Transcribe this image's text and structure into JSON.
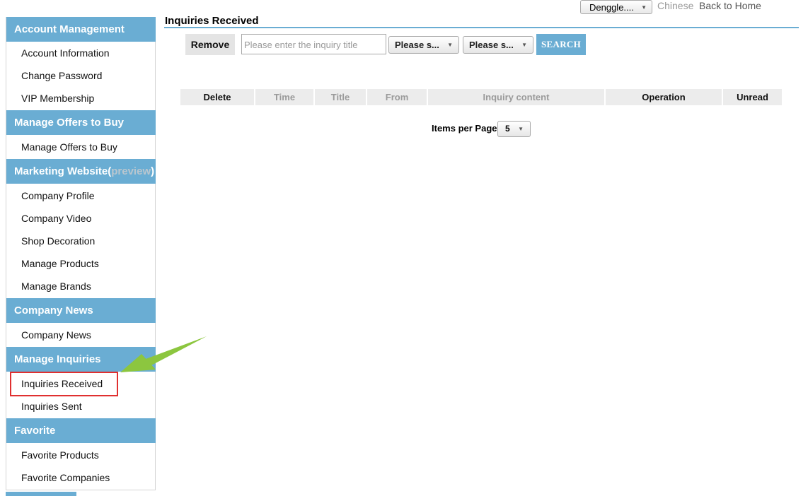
{
  "topbar": {
    "user": "Denggle....",
    "language": "Chinese",
    "home": "Back to Home"
  },
  "sidebar": {
    "sections": [
      {
        "title": "Account Management",
        "items": [
          "Account Information",
          "Change Password",
          "VIP Membership"
        ]
      },
      {
        "title": "Manage Offers to Buy",
        "items": [
          "Manage Offers to Buy"
        ]
      },
      {
        "title": "Marketing Website(",
        "title_link": "preview",
        "title_end": ")",
        "items": [
          "Company Profile",
          "Company Video",
          "Shop Decoration",
          "Manage Products",
          "Manage Brands"
        ]
      },
      {
        "title": "Company News",
        "items": [
          "Company News"
        ]
      },
      {
        "title": "Manage Inquiries",
        "items": [
          "Inquiries Received",
          "Inquiries Sent"
        ]
      },
      {
        "title": "Favorite",
        "items": [
          "Favorite Products",
          "Favorite Companies"
        ]
      }
    ],
    "highlighted_item": "Inquiries Received"
  },
  "main": {
    "title": "Inquiries Received",
    "toolbar": {
      "remove_label": "Remove",
      "search_placeholder": "Please enter the inquiry title",
      "filter1": "Please s...",
      "filter2": "Please s...",
      "search_label": "SEARCH"
    },
    "table": {
      "columns": [
        "Delete",
        "Time",
        "Title",
        "From",
        "Inquiry content",
        "Operation",
        "Unread"
      ]
    },
    "pagination": {
      "items_per_page_label": "Items per Page",
      "items_per_page_value": "5"
    }
  },
  "colors": {
    "accent": "#6aadd3",
    "highlight_box": "#e03030",
    "pointer_arrow": "#8cc63f"
  }
}
